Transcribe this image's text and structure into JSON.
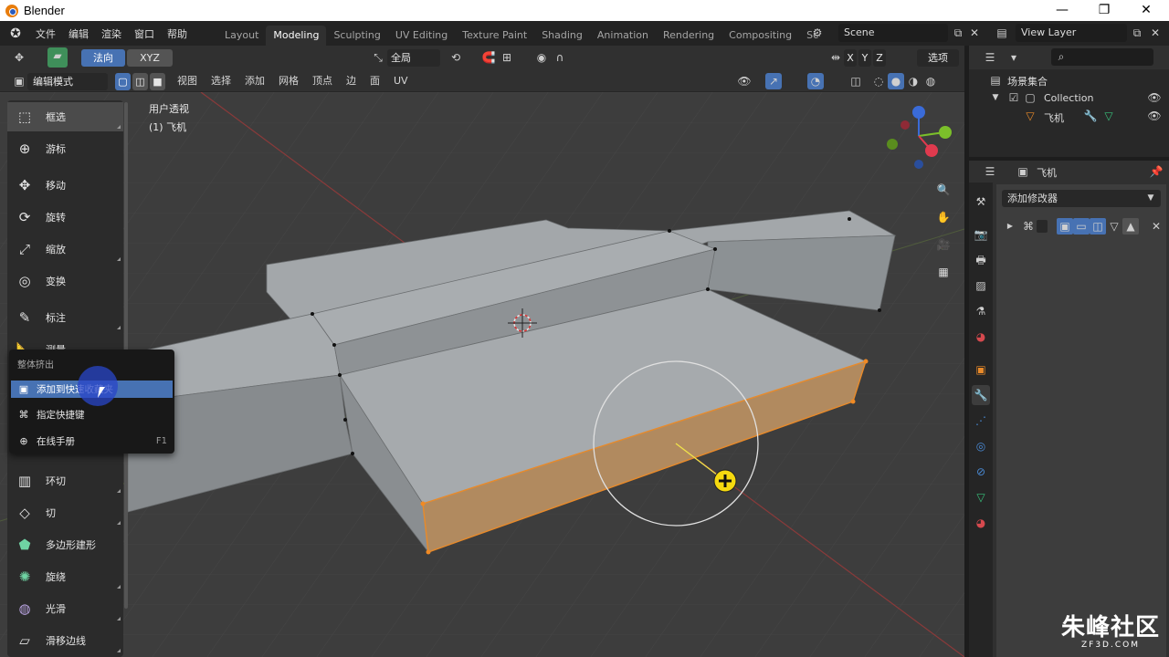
{
  "window": {
    "title": "Blender",
    "controls": [
      "—",
      "❐",
      "✕"
    ]
  },
  "menubar": {
    "items": [
      "文件",
      "编辑",
      "渲染",
      "窗口",
      "帮助"
    ]
  },
  "workspaces": {
    "tabs": [
      "Layout",
      "Modeling",
      "Sculpting",
      "UV Editing",
      "Texture Paint",
      "Shading",
      "Animation",
      "Rendering",
      "Compositing",
      "Sc"
    ],
    "active": "Modeling"
  },
  "scene": {
    "name": "Scene",
    "view_layer": "View Layer"
  },
  "viewport_header": {
    "orientation_normal": "法向",
    "orientation_xyz": "XYZ",
    "transform_global": "全局",
    "xyz_axes": [
      "X",
      "Y",
      "Z"
    ],
    "options": "选项",
    "mode": "编辑模式",
    "menus": [
      "视图",
      "选择",
      "添加",
      "网格",
      "顶点",
      "边",
      "面",
      "UV"
    ]
  },
  "viewport": {
    "view_name": "用户透视",
    "object_label": "(1) 飞机"
  },
  "toolbar": {
    "tools": [
      {
        "label": "框选",
        "icon": "select-box-icon",
        "glyph": "⬚"
      },
      {
        "label": "游标",
        "icon": "cursor-icon",
        "glyph": "⊕"
      },
      {
        "label": "移动",
        "icon": "move-icon",
        "glyph": "✥"
      },
      {
        "label": "旋转",
        "icon": "rotate-icon",
        "glyph": "⟳"
      },
      {
        "label": "缩放",
        "icon": "scale-icon",
        "glyph": "⤢"
      },
      {
        "label": "变换",
        "icon": "transform-icon",
        "glyph": "◎"
      },
      {
        "label": "标注",
        "icon": "annotate-icon",
        "glyph": "✎"
      },
      {
        "label": "测量",
        "icon": "measure-icon",
        "glyph": "📐"
      },
      {
        "label": "环切",
        "icon": "loop-cut-icon",
        "glyph": "▥"
      },
      {
        "label": "切",
        "icon": "knife-icon",
        "glyph": "◇"
      },
      {
        "label": "多边形建形",
        "icon": "poly-build-icon",
        "glyph": "⬟"
      },
      {
        "label": "旋绕",
        "icon": "spin-icon",
        "glyph": "✺"
      },
      {
        "label": "光滑",
        "icon": "smooth-icon",
        "glyph": "◍"
      },
      {
        "label": "滑移边线",
        "icon": "edge-slide-icon",
        "glyph": "▱"
      }
    ]
  },
  "context_menu": {
    "title": "整体挤出",
    "items": [
      {
        "label": "添加到快速收藏夹",
        "shortcut": "",
        "icon": "quick-favorites-icon",
        "glyph": "▣"
      },
      {
        "label": "指定快捷键",
        "shortcut": "",
        "icon": "keymap-icon",
        "glyph": "⌘"
      },
      {
        "label": "在线手册",
        "shortcut": "F1",
        "icon": "online-manual-icon",
        "glyph": "⊕"
      }
    ]
  },
  "outliner": {
    "title": "场景集合",
    "collection": "Collection",
    "object": "飞机"
  },
  "properties": {
    "object_name": "飞机",
    "add_modifier": "添加修改器"
  },
  "watermark": {
    "brand": "朱峰社区",
    "site": "ZF3D.COM"
  },
  "colors": {
    "accent": "#4772b3",
    "selected_face": "#b18a5f",
    "selection_edge": "#e88a2a",
    "mesh_face": "#9a9ea1",
    "viewport_bg": "#3d3d3d"
  }
}
